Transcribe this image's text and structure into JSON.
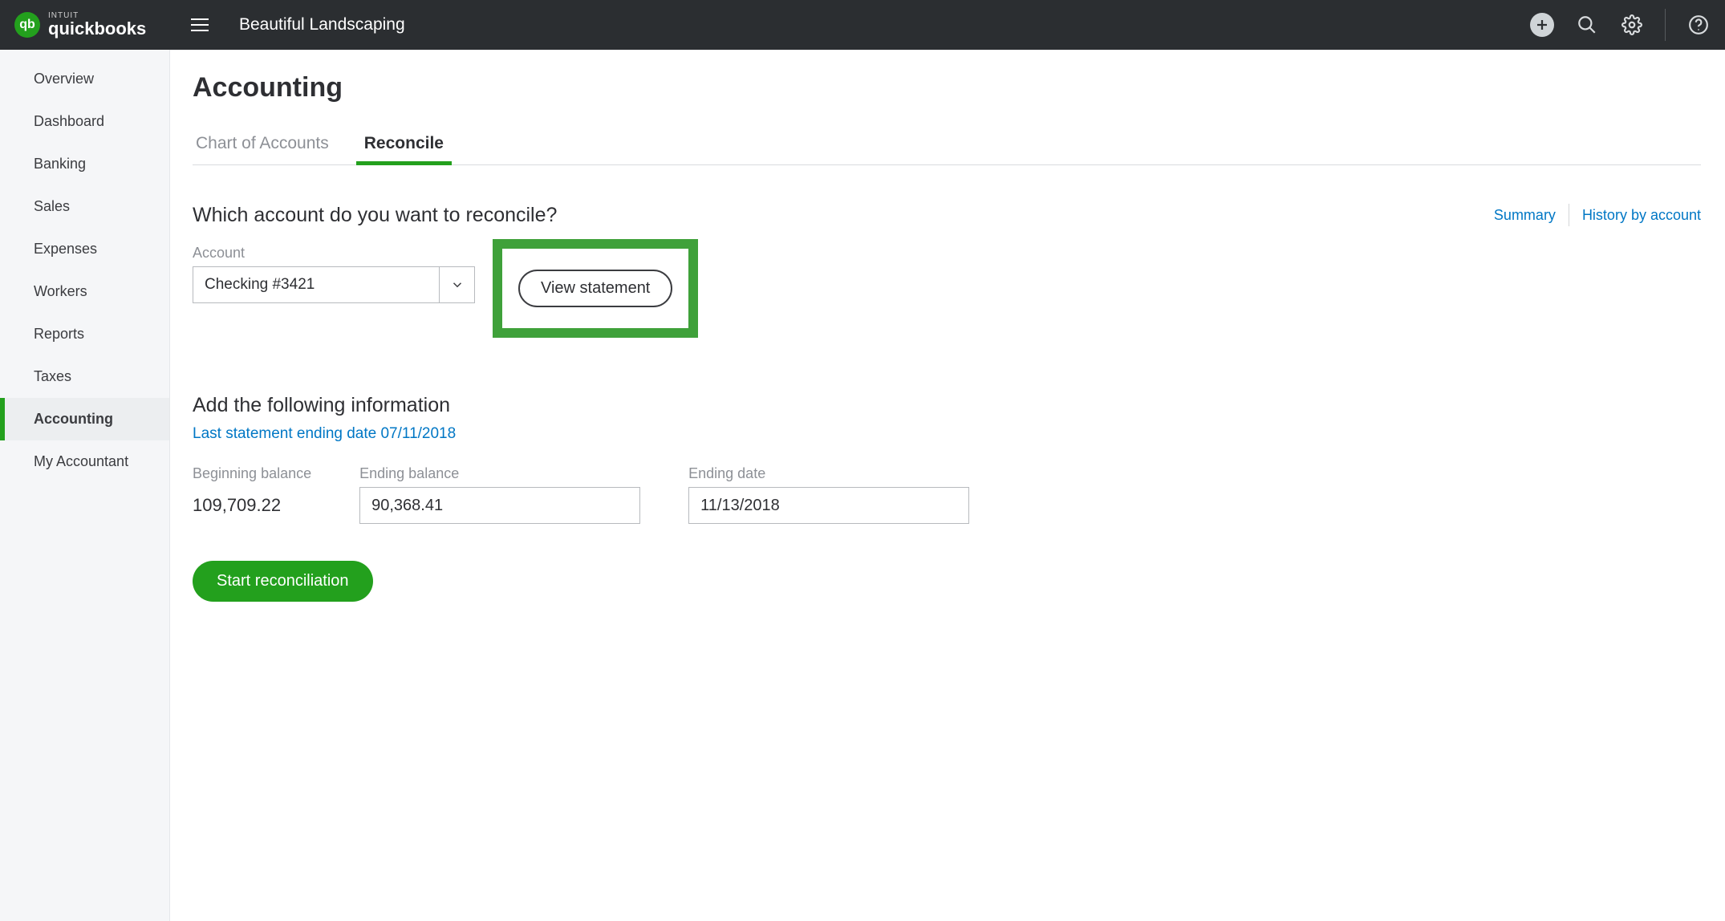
{
  "brand": {
    "intuit": "INTUIT",
    "product": "quickbooks",
    "badge": "qb"
  },
  "company_name": "Beautiful Landscaping",
  "sidebar": {
    "items": [
      {
        "label": "Overview"
      },
      {
        "label": "Dashboard"
      },
      {
        "label": "Banking"
      },
      {
        "label": "Sales"
      },
      {
        "label": "Expenses"
      },
      {
        "label": "Workers"
      },
      {
        "label": "Reports"
      },
      {
        "label": "Taxes"
      },
      {
        "label": "Accounting"
      },
      {
        "label": "My Accountant"
      }
    ],
    "active_index": 8
  },
  "page": {
    "title": "Accounting",
    "tabs": [
      {
        "label": "Chart of Accounts"
      },
      {
        "label": "Reconcile"
      }
    ],
    "active_tab_index": 1
  },
  "reconcile": {
    "question": "Which account do you want to reconcile?",
    "links": {
      "summary": "Summary",
      "history": "History by account"
    },
    "account_label": "Account",
    "account_value": "Checking #3421",
    "view_statement_label": "View statement",
    "add_info_heading": "Add the following information",
    "last_statement_text": "Last statement ending date 07/11/2018",
    "beginning_balance_label": "Beginning balance",
    "beginning_balance_value": "109,709.22",
    "ending_balance_label": "Ending balance",
    "ending_balance_value": "90,368.41",
    "ending_date_label": "Ending date",
    "ending_date_value": "11/13/2018",
    "start_button_label": "Start reconciliation"
  }
}
